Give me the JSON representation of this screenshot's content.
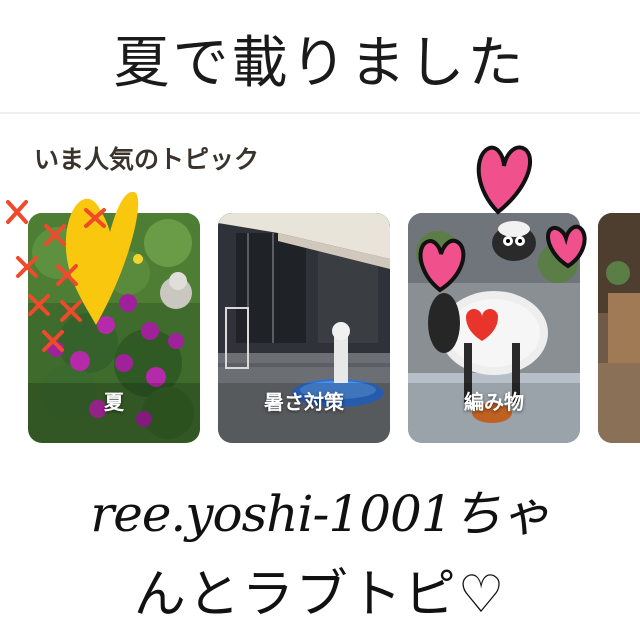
{
  "header": {
    "title": "夏で載りました"
  },
  "section": {
    "label": "いま人気のトピック"
  },
  "topics": [
    {
      "label": "夏",
      "image": "summer-garden-flowers-photo"
    },
    {
      "label": "暑さ対策",
      "image": "shaded-patio-photo"
    },
    {
      "label": "編み物",
      "image": "knitted-sheep-doll-photo"
    },
    {
      "label": "",
      "image": "interior-photo-partial"
    }
  ],
  "annotations": {
    "yellow_heart_color": "#f9c80e",
    "pink_heart_color": "#f0508c",
    "cross_marks_color": "#ef4a2c"
  },
  "caption": {
    "line1": "ree.yoshi-1001ちゃ",
    "line2": "んとラブトピ♡"
  }
}
